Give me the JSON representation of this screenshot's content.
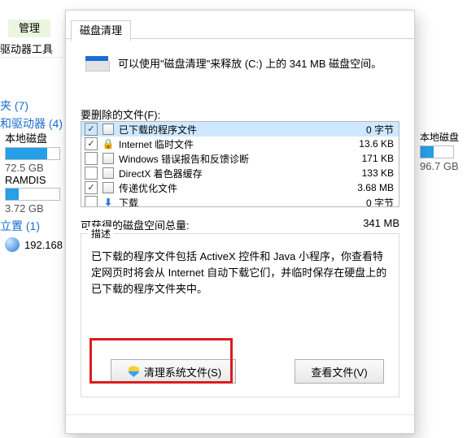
{
  "bg": {
    "tab": "管理",
    "tools": "驱动器工具",
    "cat1": "夹 (7)",
    "cat2": "和驱动器 (4)",
    "drive1": {
      "label": "本地磁盘",
      "size": "72.5 GB",
      "fill": 78
    },
    "drive2": {
      "label": "RAMDIS",
      "size": "3.72 GB",
      "fill": 24
    },
    "cat3": "立置 (1)",
    "ip": "192.168"
  },
  "rdrive": {
    "label": "本地磁盘",
    "size": "96.7 GB",
    "fill": 40
  },
  "dialog": {
    "tab": "磁盘清理",
    "intro": "可以使用\"磁盘清理\"来释放  (C:) 上的 341 MB 磁盘空间。",
    "section_label": "要删除的文件(F):",
    "rows": [
      {
        "checked": true,
        "icon": "generic",
        "name": "已下载的程序文件",
        "value": "0 字节",
        "selected": true
      },
      {
        "checked": true,
        "icon": "lock",
        "name": "Internet 临时文件",
        "value": "13.6 KB",
        "selected": false
      },
      {
        "checked": false,
        "icon": "generic",
        "name": "Windows 错误报告和反馈诊断",
        "value": "171 KB",
        "selected": false
      },
      {
        "checked": false,
        "icon": "generic",
        "name": "DirectX 着色器缓存",
        "value": "133 KB",
        "selected": false
      },
      {
        "checked": true,
        "icon": "generic",
        "name": "传递优化文件",
        "value": "3.68 MB",
        "selected": false
      },
      {
        "checked": false,
        "icon": "down",
        "name": "下载",
        "value": "0 字节",
        "selected": false
      }
    ],
    "reclaim_label": "可获得的磁盘空间总量:",
    "reclaim_value": "341 MB",
    "group_legend": "描述",
    "group_desc": "已下载的程序文件包括 ActiveX 控件和 Java 小程序，你查看特定网页时将会从 Internet 自动下载它们，并临时保存在硬盘上的已下载的程序文件夹中。",
    "btn_clean": "清理系统文件(S)",
    "btn_view": "查看文件(V)"
  }
}
